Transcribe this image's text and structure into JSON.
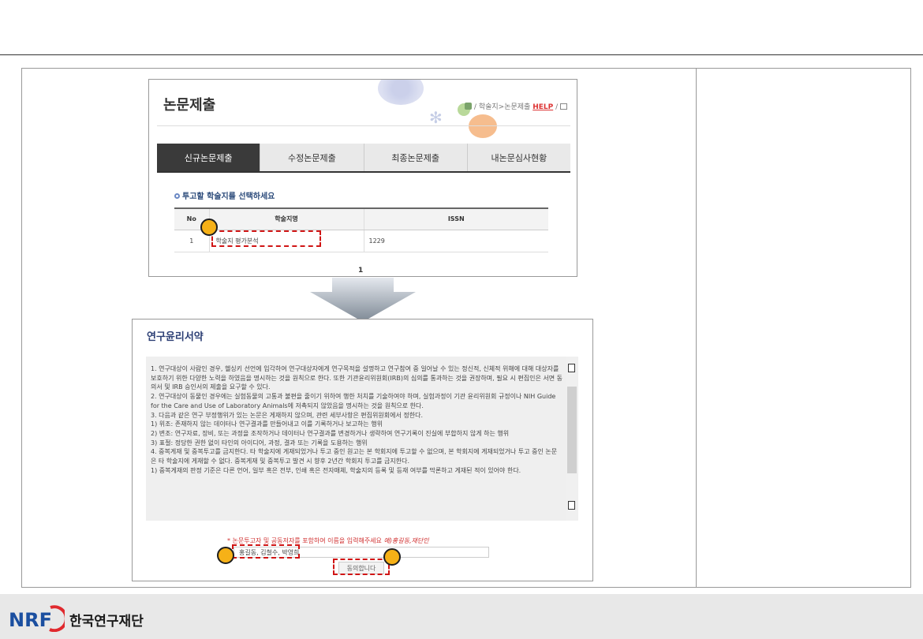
{
  "panel1": {
    "title": "논문제출",
    "breadcrumb": {
      "path": "학술지>논문제출",
      "help": "HELP"
    },
    "tabs": [
      {
        "label": "신규논문제출",
        "active": true
      },
      {
        "label": "수정논문제출",
        "active": false
      },
      {
        "label": "최종논문제출",
        "active": false
      },
      {
        "label": "내논문심사현황",
        "active": false
      }
    ],
    "select_title": "투고할 학술지를 선택하세요",
    "table": {
      "headers": [
        "No",
        "학술지명",
        "ISSN"
      ],
      "rows": [
        {
          "no": "1",
          "name": "학술지 평가분석",
          "issn": "1229"
        }
      ]
    },
    "pagination": "1"
  },
  "panel2": {
    "title": "연구윤리서약",
    "ethics_text": [
      "1. 연구대상이 사람인 경우, 헬싱키 선언에 입각하여 연구대상자에게 연구목적을 설명하고 연구참여 중 일어날 수 있는 정신적, 신체적 위해에 대해 대상자를 보호하기 위한 다양한 노력을 하였음을 명시하는 것을 원칙으로 한다. 또한 기관윤리위원회(IRB)의 심의를 통과하는 것을 권장하며, 필요 시 편집인은 서면 동의서 및 IRB 승인서의 제출을 요구할 수 있다.",
      "2. 연구대상이 동물인 경우에는 실험동물의 고통과 불편을 줄이기 위하여 행한 처치를 기술하여야 하며, 실험과정이 기관 윤리위원회 규정이나 NIH Guide for the Care and Use of Laboratory Animals에 저촉되지 않았음을 명시하는 것을 원칙으로 한다.",
      "3. 다음과 같은 연구 부정행위가 있는 논문은 게재하지 않으며, 관련 세부사항은 편집위원회에서 정한다.",
      "1) 위조: 존재하지 않는 데이터나 연구결과를 만들어내고 이를 기록하거나 보고하는 행위",
      "2) 변조: 연구자료, 장비, 또는 과정을 조작하거나 데이터나 연구결과를 변경하거나 생략하여 연구기록이 진실에 부합하지 않게 하는 행위",
      "3) 표절: 정당한 권한 없이 타인의 아이디어, 과정, 결과 또는 기록을 도용하는 행위",
      "4. 중복게재 및 중복투고를 금지한다. 타 학술지에 게재되었거나 투고 중인 원고는 본 학회지에 투고할 수 없으며, 본 학회지에 게재되었거나 투고 중인 논문은 타 학술지에 게재할 수 없다. 중복게재 및 중복투고 발견 시 향후 2년간 학회지 투고를 금지한다.",
      "1) 중복게재의 판정 기준은 다른 언어, 일부 혹은 전부, 인쇄 혹은 전자매체, 학술지의 등록 및 등재 여부를 막론하고 게재된 적이 있어야 한다."
    ],
    "notice": "* 논문투고자 및 공동저자를 포함하여 이름을 입력해주세요",
    "notice_example": "예)홍길동,재단인",
    "name_input_value": "홍길동, 김철수, 박영희",
    "agree_label": "동의합니다"
  },
  "footer": {
    "logo_letters": "NRF",
    "org_name": "한국연구재단"
  },
  "colors": {
    "marker": "#f6b117",
    "highlight_border": "#d01515",
    "active_tab": "#3a3a3a",
    "footer_bg": "#e8e8e8",
    "logo_blue": "#1b4fa0",
    "logo_red": "#e0292e"
  }
}
